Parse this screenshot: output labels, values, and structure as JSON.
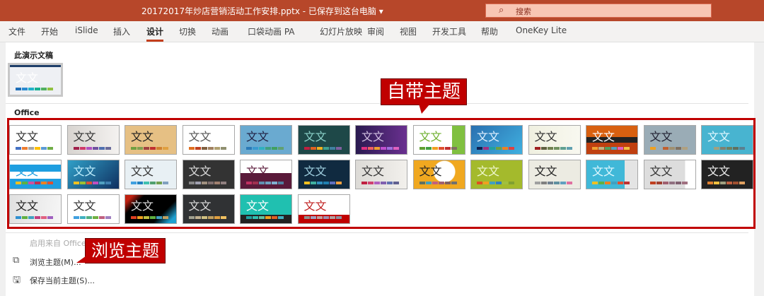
{
  "titlebar": {
    "title": "20172017年炒店营销活动工作安排.pptx - 已保存到这台电脑 ▾",
    "search_placeholder": "搜索",
    "search_icon": "search-icon"
  },
  "tabs": [
    "文件",
    "开始",
    "iSlide",
    "插入",
    "设计",
    "切换",
    "动画",
    "口袋动画 PA",
    "幻灯片放映",
    "审阅",
    "视图",
    "开发工具",
    "帮助",
    "OneKey Lite"
  ],
  "active_tab": "设计",
  "sections": {
    "current": "此演示文稿",
    "office": "Office"
  },
  "sample_text": "文文",
  "current_theme": {
    "bg": "#eef0f4",
    "text": "#ffffff",
    "swatches": [
      "#1f6fb8",
      "#2a8ad0",
      "#20b0c8",
      "#18b090",
      "#50b060",
      "#90c040"
    ]
  },
  "themes": [
    {
      "bg": "#ffffff",
      "text": "#333",
      "swatches": [
        "#4472c4",
        "#ed7d31",
        "#a5a5a5",
        "#ffc000",
        "#5b9bd5",
        "#70ad47"
      ]
    },
    {
      "bg": "linear-gradient(90deg,#d8d4d0,#f4f2f0)",
      "text": "#333",
      "swatches": [
        "#a0204a",
        "#d03a6a",
        "#b050c0",
        "#7050a0",
        "#5070b0",
        "#6a6a9a"
      ]
    },
    {
      "bg": "#e6c084",
      "text": "#222",
      "swatches": [
        "#70a040",
        "#80a050",
        "#a04040",
        "#c03030",
        "#d08030",
        "#e0a040"
      ]
    },
    {
      "bg": "#ffffff",
      "text": "#555",
      "swatches": [
        "#e07020",
        "#c04020",
        "#806040",
        "#a08060",
        "#b0a070",
        "#909070"
      ]
    },
    {
      "bg": "#6aaad0",
      "text": "#224",
      "swatches": [
        "#2a7ab8",
        "#3a9ad0",
        "#30b0c0",
        "#40a080",
        "#40a060",
        "#60a070"
      ]
    },
    {
      "bg": "#1e4848",
      "text": "#8ad0c8",
      "swatches": [
        "#c02040",
        "#e06020",
        "#f0b020",
        "#40a090",
        "#4080a0",
        "#8060a0"
      ]
    },
    {
      "bg": "linear-gradient(90deg,#2a1a50,#6a3090)",
      "text": "#d0c0e0",
      "swatches": [
        "#e03080",
        "#f06060",
        "#f0a030",
        "#c050d0",
        "#a070e0",
        "#e060c0"
      ]
    },
    {
      "bg": "linear-gradient(90deg,#fff 75%,#80c040 75%)",
      "text": "#70b030",
      "swatches": [
        "#60a030",
        "#40a040",
        "#f0a020",
        "#e05030",
        "#c03030",
        "#807060"
      ]
    },
    {
      "bg": "linear-gradient(135deg,#2a70b0,#40b0e0)",
      "text": "#e0f0ff",
      "swatches": [
        "#102050",
        "#a03080",
        "#20a0a0",
        "#70a040",
        "#f08020",
        "#e04040"
      ]
    },
    {
      "bg": "linear-gradient(90deg,#f0f0e0,#f8f8f0)",
      "text": "#333",
      "swatches": [
        "#a02020",
        "#606040",
        "#708050",
        "#709060",
        "#60a090",
        "#60a0b0"
      ]
    },
    {
      "bg": "linear-gradient(180deg,#d86010 40%,#222 40%,#222 60%,#c04010 60%)",
      "text": "#fff",
      "swatches": [
        "#f0a030",
        "#c0b080",
        "#50a060",
        "#50a0c0",
        "#e060c0",
        "#f0c040"
      ]
    },
    {
      "bg": "#9aacb6",
      "text": "#223",
      "swatches": [
        "#f0a020",
        "#9aacb6",
        "#c06030",
        "#a09070",
        "#807060",
        "#b0a080"
      ]
    },
    {
      "bg": "#48b4d0",
      "text": "#e0f8ff",
      "swatches": [
        "#48b4d0",
        "#a0a080",
        "#808070",
        "#708060",
        "#607060",
        "#5a8090"
      ]
    },
    {
      "bg": "linear-gradient(180deg,#fff 15%,#1e9ee0 15%,#1e9ee0 40%,#fff 40%,#fff 65%,#1e9ee0 65%)",
      "text": "#1e9ee0",
      "swatches": [
        "#f0c020",
        "#60b040",
        "#d050a0",
        "#c03050",
        "#f08020",
        "#e05030"
      ]
    },
    {
      "bg": "linear-gradient(135deg,#30a0c8,#103060)",
      "text": "#c0f0ff",
      "swatches": [
        "#f0c020",
        "#a0c030",
        "#e05030",
        "#c050c0",
        "#50a0c0",
        "#4080b0"
      ]
    },
    {
      "bg": "#e8f0f4",
      "text": "#333",
      "swatches": [
        "#40a0e0",
        "#2080c0",
        "#40c0b0",
        "#50a070",
        "#70a050",
        "#80a0c0"
      ]
    },
    {
      "bg": "#333333",
      "text": "#ddd",
      "swatches": [
        "#888",
        "#a0a0b0",
        "#a09080",
        "#807070",
        "#a08070",
        "#908080"
      ]
    },
    {
      "bg": "linear-gradient(180deg,#fff 45%,#5a1a3a 45%)",
      "text": "#5a1a3a",
      "swatches": [
        "#c03060",
        "#a03050",
        "#6090b0",
        "#70a0c0",
        "#80b0d0",
        "#5080a0"
      ]
    },
    {
      "bg": "#102a40",
      "text": "#a0d0e0",
      "swatches": [
        "#f0c020",
        "#40b0a0",
        "#3090c0",
        "#2080b0",
        "#6070c0",
        "#f0a040"
      ]
    },
    {
      "bg": "linear-gradient(90deg,#dcdad6,#f2f0ec)",
      "text": "#333",
      "swatches": [
        "#c02040",
        "#d04070",
        "#b060c0",
        "#8060b0",
        "#6070b0",
        "#606090"
      ]
    },
    {
      "bg": "radial-gradient(circle at 60% 40%,#fff 30%,#f0a820 32%)",
      "text": "#222",
      "swatches": [
        "#607060",
        "#40a0c0",
        "#c06080",
        "#a06070",
        "#806060",
        "#707070"
      ]
    },
    {
      "bg": "#a4ba2c",
      "text": "#f0f8d0",
      "swatches": [
        "#e05020",
        "#f0a020",
        "#40a0c0",
        "#3080c0",
        "#a0c040",
        "#80a030"
      ]
    },
    {
      "bg": "#ecebe2",
      "text": "#222",
      "swatches": [
        "#a0a0a0",
        "#808080",
        "#708090",
        "#6090a0",
        "#60a0c0",
        "#e070a0"
      ]
    },
    {
      "bg": "linear-gradient(90deg,#40b8d8 75%,#e4e4e4 75%)",
      "text": "#e0f8ff",
      "swatches": [
        "#f0c020",
        "#60b040",
        "#f08020",
        "#40a0c0",
        "#e05030",
        "#c03030"
      ]
    },
    {
      "bg": "linear-gradient(90deg,#ddd 80%,#fff 80%)",
      "text": "#333",
      "swatches": [
        "#c04020",
        "#a04030",
        "#a06070",
        "#907080",
        "#806070",
        "#a07080"
      ]
    },
    {
      "bg": "#222222",
      "text": "#eee",
      "swatches": [
        "#e08030",
        "#f0c040",
        "#a0a080",
        "#c06040",
        "#a05030",
        "#e0a060"
      ]
    },
    {
      "bg": "linear-gradient(100deg,#e0e0e0,#f6f6f6)",
      "text": "#222",
      "swatches": [
        "#3090d0",
        "#60b040",
        "#40a0c0",
        "#c04080",
        "#e06080",
        "#a060c0"
      ]
    },
    {
      "bg": "#ffffff",
      "text": "#333",
      "swatches": [
        "#40a0e0",
        "#40b0c0",
        "#50b080",
        "#70b040",
        "#c06080",
        "#a080c0"
      ]
    },
    {
      "bg": "linear-gradient(135deg,#c02010 10%,#000 25%,#000 70%,#20a0d0 90%)",
      "text": "#ddd",
      "swatches": [
        "#e04020",
        "#f0a020",
        "#c0c040",
        "#60b040",
        "#40a0c0",
        "#c0a060"
      ]
    },
    {
      "bg": "#303234",
      "text": "#ddd",
      "swatches": [
        "#a0a090",
        "#c0b090",
        "#d0c080",
        "#c0a060",
        "#e0a040",
        "#f0c060"
      ]
    },
    {
      "bg": "linear-gradient(180deg,#20c0b0 70%,#222 70%)",
      "text": "#fff",
      "swatches": [
        "#20a0a0",
        "#30c0b0",
        "#60c0a0",
        "#f0a020",
        "#e06020",
        "#40b0c0"
      ]
    },
    {
      "bg": "linear-gradient(180deg,#fff 70%,#c00000 70%)",
      "text": "#c02020",
      "swatches": [
        "#909090",
        "#a0a0c0",
        "#c0a0a0",
        "#a090b0",
        "#b0a0a0",
        "#9090a0"
      ]
    }
  ],
  "callouts": {
    "builtin": "自带主题",
    "browse": "浏览主题"
  },
  "menu": {
    "enable_office": "启用来自 Office.com 的内容更新...",
    "browse": "浏览主题(M)...",
    "save": "保存当前主题(S)..."
  }
}
